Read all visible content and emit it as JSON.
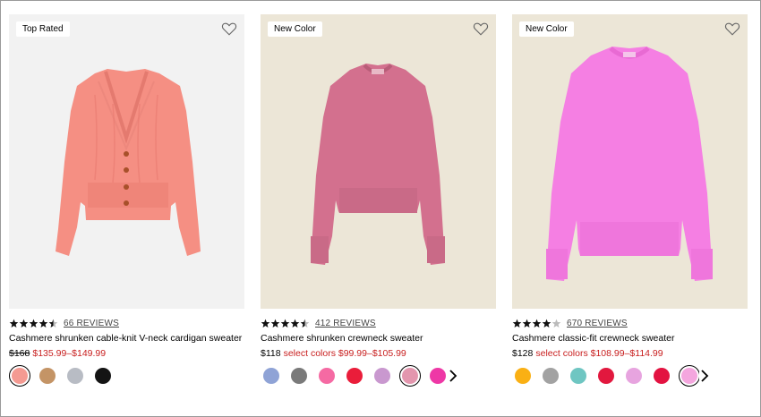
{
  "products": [
    {
      "badge": "Top Rated",
      "rating": 4.5,
      "reviews": "66 REVIEWS",
      "name": "Cashmere shrunken cable-knit V-neck cardigan sweater",
      "price_original": "$168",
      "price_sale": "$135.99–$149.99",
      "image_color": "#f58f83",
      "swatches": [
        "#f49a92",
        "#c49466",
        "#b8bcc4",
        "#141414"
      ],
      "selected_swatch": 0,
      "has_more_arrow": false
    },
    {
      "badge": "New Color",
      "rating": 4.5,
      "reviews": "412 REVIEWS",
      "name": "Cashmere shrunken crewneck sweater",
      "price_original": "$118",
      "price_sale": "select colors $99.99–$105.99",
      "image_color": "#d3708e",
      "swatches": [
        "#8fa3d6",
        "#7a7a7a",
        "#f56aa3",
        "#ea1d3a",
        "#c998cf",
        "#e396ae",
        "#ee38a6"
      ],
      "selected_swatch": 5,
      "has_more_arrow": true
    },
    {
      "badge": "New Color",
      "rating": 4,
      "reviews": "670 REVIEWS",
      "name": "Cashmere classic-fit crewneck sweater",
      "price_original": "$128",
      "price_sale": "select colors $108.99–$114.99",
      "image_color": "#f57fe3",
      "swatches": [
        "#fab014",
        "#a2a2a2",
        "#6fc6c2",
        "#e2183e",
        "#e7a4df",
        "#e31341",
        "#f4a6de"
      ],
      "selected_swatch": 6,
      "has_more_arrow": true
    }
  ],
  "icons": {
    "favorite": "heart-outline-icon",
    "more": "chevron-right-icon",
    "star": "star-icon"
  }
}
